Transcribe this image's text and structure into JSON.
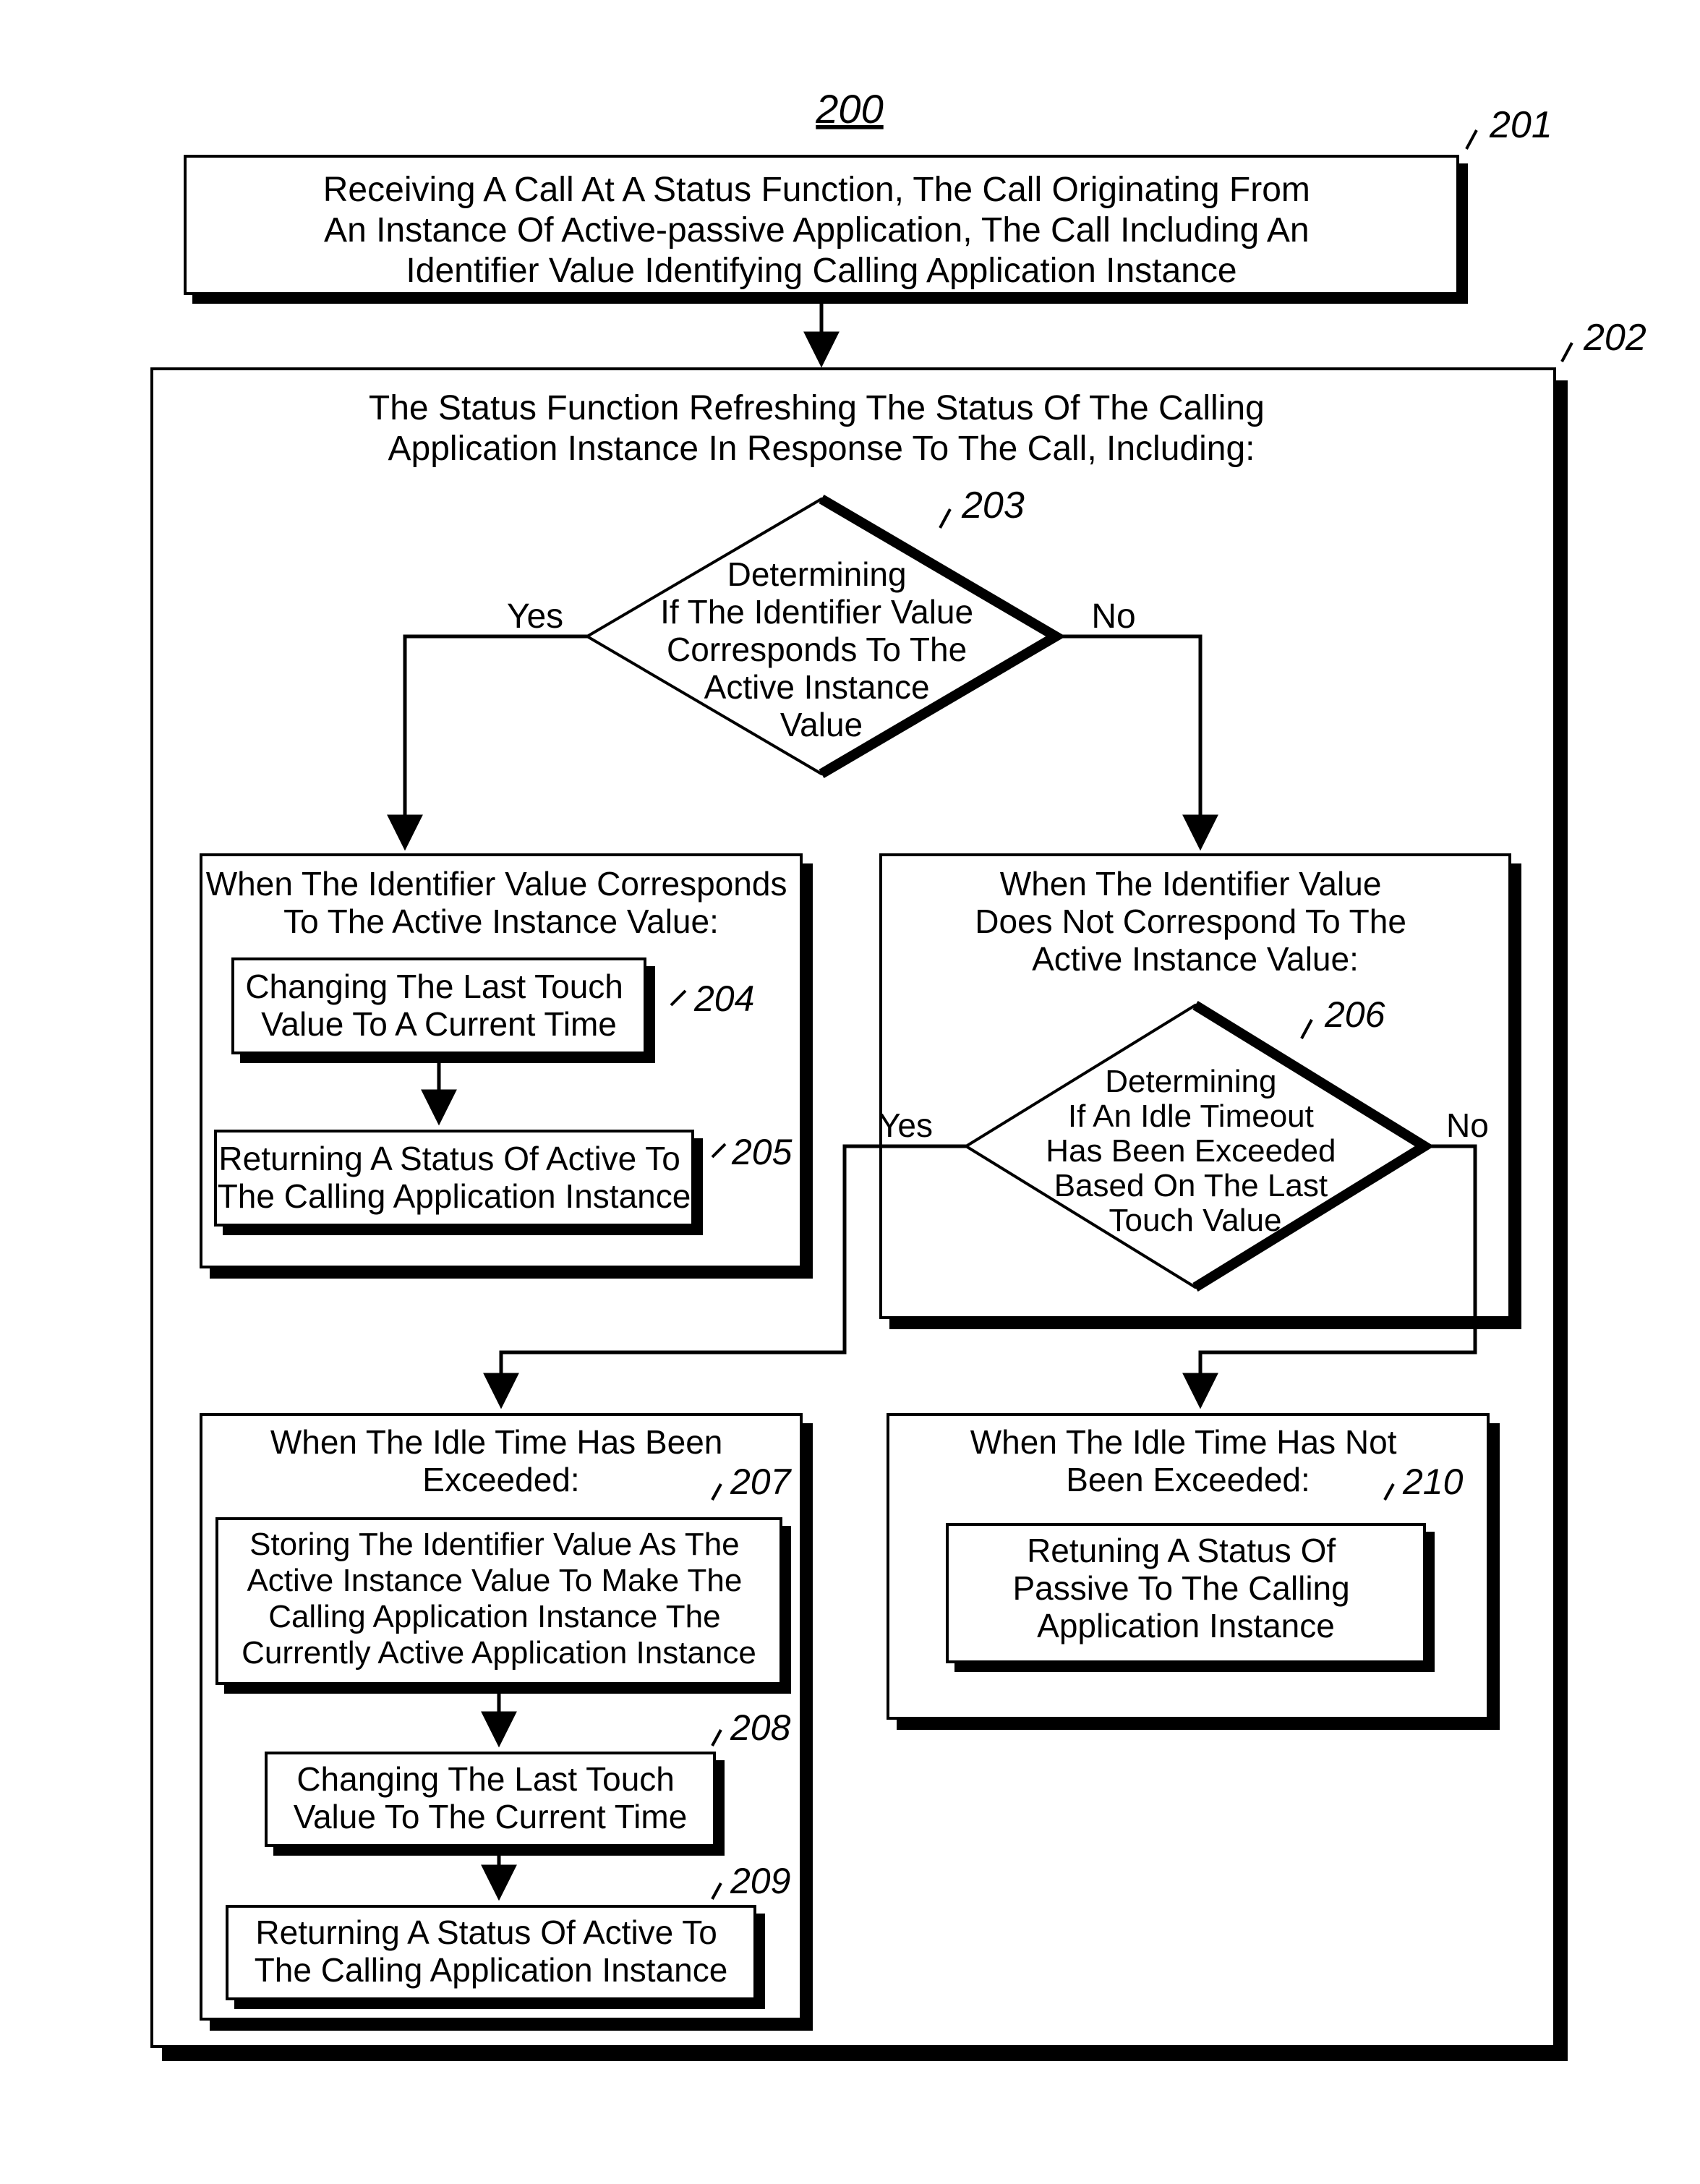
{
  "title": "200",
  "labels": {
    "201": "201",
    "202": "202",
    "203": "203",
    "204": "204",
    "205": "205",
    "206": "206",
    "207": "207",
    "208": "208",
    "209": "209",
    "210": "210",
    "yes1": "Yes",
    "no1": "No",
    "yes2": "Yes",
    "no2": "No"
  },
  "box201": {
    "l1": "Receiving A Call At A Status Function, The Call Originating From",
    "l2": "An Instance Of Active-passive Application, The Call Including An",
    "l3": "Identifier Value Identifying Calling Application Instance"
  },
  "box202": {
    "l1": "The Status Function Refreshing The Status Of The Calling",
    "l2": "Application Instance In Response To The Call, Including:"
  },
  "d203": {
    "l1": "Determining",
    "l2": "If The Identifier Value",
    "l3": "Corresponds To The",
    "l4": "Active Instance",
    "l5": "Value"
  },
  "leftHdr": {
    "l1": "When The Identifier Value Corresponds",
    "l2": "To The Active Instance Value:"
  },
  "rightHdr": {
    "l1": "When The Identifier Value",
    "l2": "Does Not Correspond To The",
    "l3": "Active Instance Value:"
  },
  "b204": {
    "l1": "Changing The Last Touch",
    "l2": "Value To A Current Time"
  },
  "b205": {
    "l1": "Returning A Status Of Active To",
    "l2": "The Calling Application Instance"
  },
  "d206": {
    "l1": "Determining",
    "l2": "If An Idle Timeout",
    "l3": "Has Been Exceeded",
    "l4": "Based On The Last",
    "l5": "Touch Value"
  },
  "b207hdr": {
    "l1": "When The Idle Time Has Been",
    "l2": "Exceeded:"
  },
  "b207": {
    "l1": "Storing The Identifier Value As The",
    "l2": "Active Instance Value To Make The",
    "l3": "Calling Application Instance The",
    "l4": "Currently Active Application Instance"
  },
  "b208": {
    "l1": "Changing The Last Touch",
    "l2": "Value To The Current Time"
  },
  "b209": {
    "l1": "Returning A Status Of Active To",
    "l2": "The Calling Application Instance"
  },
  "b210hdr": {
    "l1": "When The Idle Time Has Not",
    "l2": "Been Exceeded:"
  },
  "b210": {
    "l1": "Retuning A Status Of",
    "l2": "Passive To The Calling",
    "l3": "Application Instance"
  }
}
